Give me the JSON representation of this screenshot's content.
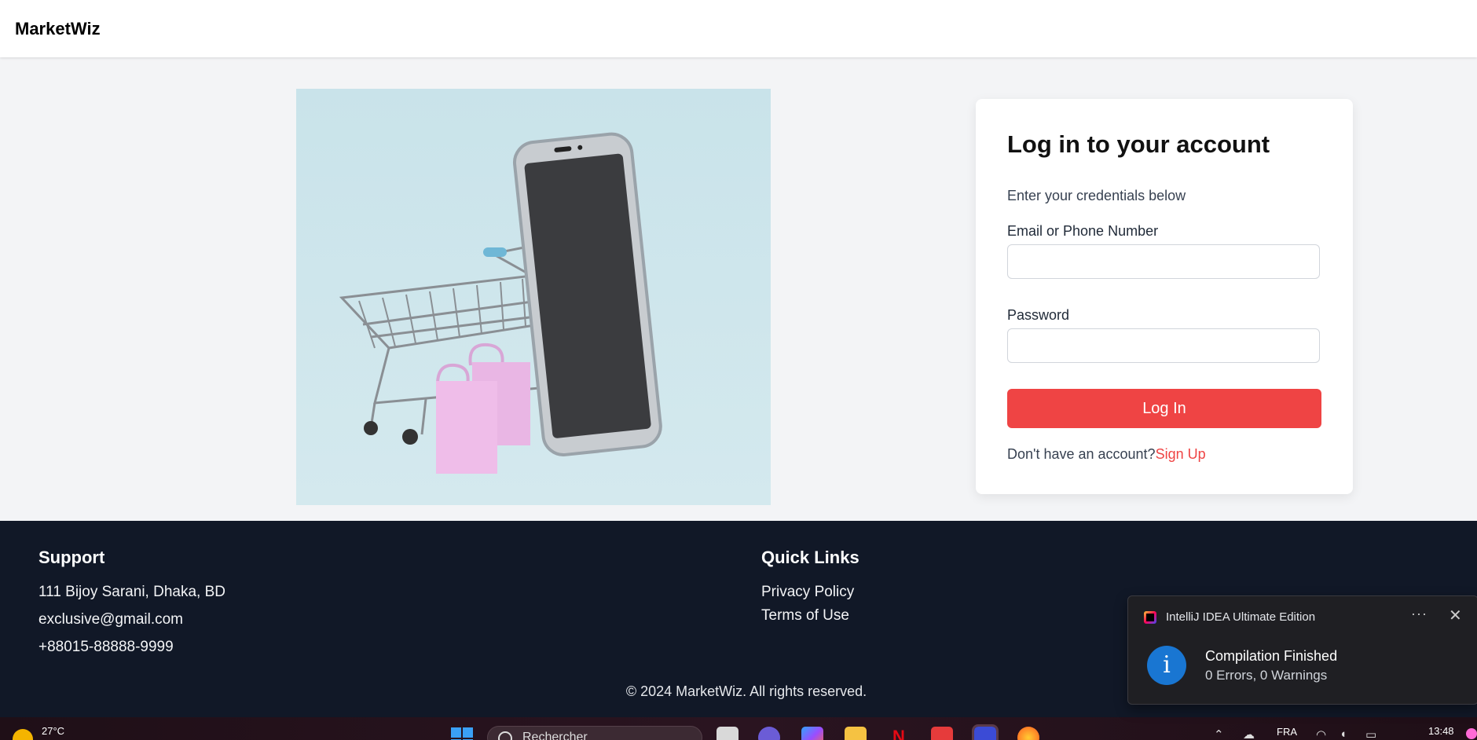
{
  "header": {
    "brand": "MarketWiz"
  },
  "login": {
    "title": "Log in to your account",
    "subtitle": "Enter your credentials below",
    "email_label": "Email or Phone Number",
    "email_value": "",
    "password_label": "Password",
    "password_value": "",
    "submit_label": "Log In",
    "no_account_text": "Don't have an account?",
    "signup_label": "Sign Up"
  },
  "footer": {
    "support": {
      "heading": "Support",
      "address": "111 Bijoy Sarani, Dhaka, BD",
      "email": "exclusive@gmail.com",
      "phone": "+88015-88888-9999"
    },
    "quick_links": {
      "heading": "Quick Links",
      "items": [
        "Privacy Policy",
        "Terms of Use"
      ]
    },
    "copyright": "© 2024 MarketWiz. All rights reserved."
  },
  "notification": {
    "app_name": "IntelliJ IDEA Ultimate Edition",
    "title": "Compilation Finished",
    "message": "0 Errors, 0 Warnings",
    "icon": "info-icon"
  },
  "taskbar": {
    "weather": "27°C",
    "search_placeholder": "Rechercher",
    "language": "FRA",
    "time": "13:48"
  },
  "colors": {
    "accent": "#ef4444",
    "footer_bg": "#111827",
    "page_bg": "#f3f4f6"
  }
}
